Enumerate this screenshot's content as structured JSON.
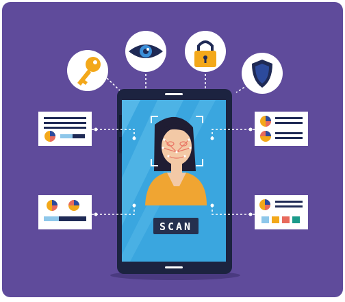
{
  "illustration": {
    "scan_label": "SCAN",
    "icons": [
      "key-icon",
      "eye-icon",
      "padlock-icon",
      "shield-icon"
    ],
    "colors": {
      "background": "#5f4b9b",
      "phone_body": "#1c2340",
      "screen": "#3aa6df",
      "screen_light": "#67c3ee",
      "circle": "#ffffff",
      "key": "#f3a81a",
      "padlock": "#f3a81a",
      "eye_iris": "#3a8fd8",
      "shield": "#2c4a9c",
      "shirt": "#f0a532",
      "skin": "#f3c9a6",
      "hair": "#1f1d33",
      "scan_badge": "#25304f"
    }
  }
}
